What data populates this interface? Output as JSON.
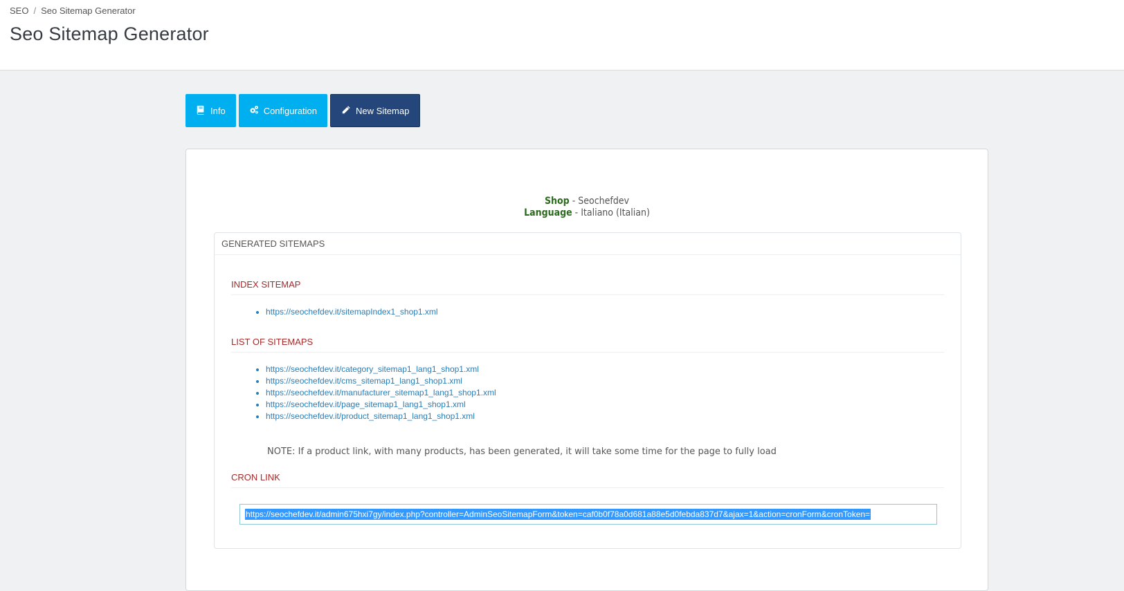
{
  "breadcrumb": {
    "parent": "SEO",
    "separator": "/",
    "current": "Seo Sitemap Generator"
  },
  "page_title": "Seo Sitemap Generator",
  "tabs": [
    {
      "label": "Info",
      "icon": "book-icon",
      "active": false
    },
    {
      "label": "Configuration",
      "icon": "cogs-icon",
      "active": false
    },
    {
      "label": "New Sitemap",
      "icon": "pencil-icon",
      "active": true
    }
  ],
  "shop": {
    "label": "Shop",
    "separator": " - ",
    "value": "Seochefdev"
  },
  "language": {
    "label": "Language",
    "separator": " - ",
    "value": "Italiano (Italian)"
  },
  "generated": {
    "heading": "GENERATED SITEMAPS",
    "index_title": "INDEX SITEMAP",
    "index_links": [
      "https://seochefdev.it/sitemapIndex1_shop1.xml"
    ],
    "list_title": "LIST OF SITEMAPS",
    "list_links": [
      "https://seochefdev.it/category_sitemap1_lang1_shop1.xml",
      "https://seochefdev.it/cms_sitemap1_lang1_shop1.xml",
      "https://seochefdev.it/manufacturer_sitemap1_lang1_shop1.xml",
      "https://seochefdev.it/page_sitemap1_lang1_shop1.xml",
      "https://seochefdev.it/product_sitemap1_lang1_shop1.xml"
    ],
    "note": "NOTE: If a product link, with many products, has been generated, it will take some time for the page to fully load",
    "cron_title": "CRON LINK",
    "cron_link": "https://seochefdev.it/admin675hxi7gy/index.php?controller=AdminSeoSitemapForm&token=caf0b0f78a0d681a88e5d0febda837d7&ajax=1&action=cronForm&cronToken="
  },
  "colors": {
    "tab_primary": "#00aff0",
    "tab_active": "#25467b",
    "section_title": "#a52a2a",
    "info_label": "#2b6b1c",
    "link": "#2a7cb4",
    "selection": "#3399ff"
  }
}
